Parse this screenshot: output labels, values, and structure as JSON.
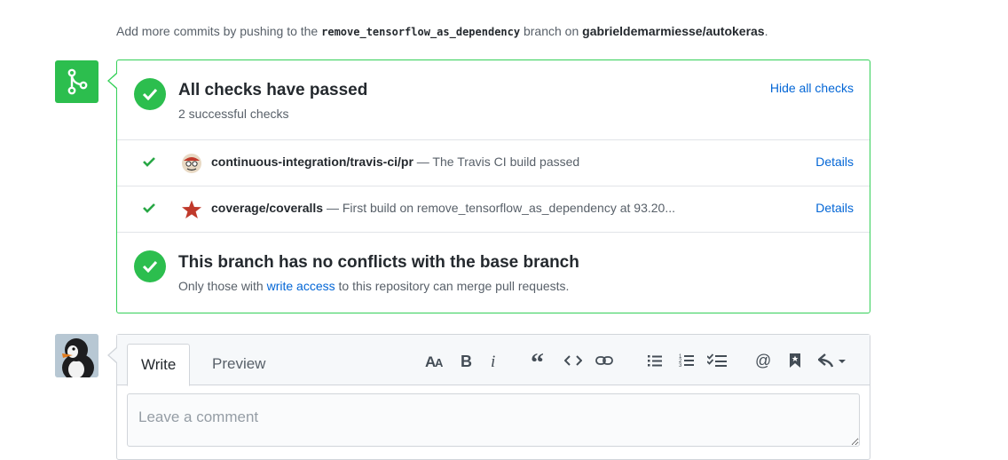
{
  "hint": {
    "prefix": "Add more commits by pushing to the",
    "branch": "remove_tensorflow_as_dependency",
    "middle": "branch on",
    "repo": "gabrieldemarmiesse/autokeras",
    "suffix": "."
  },
  "checks": {
    "title": "All checks have passed",
    "subtitle": "2 successful checks",
    "hide_label": "Hide all checks",
    "items": [
      {
        "name": "continuous-integration/travis-ci/pr",
        "description": "— The Travis CI build passed",
        "details_label": "Details",
        "icon": "travis-avatar-icon"
      },
      {
        "name": "coverage/coveralls",
        "description": "— First build on remove_tensorflow_as_dependency at 93.20...",
        "details_label": "Details",
        "icon": "coveralls-star-icon"
      }
    ]
  },
  "conflicts": {
    "title": "This branch has no conflicts with the base branch",
    "sub_prefix": "Only those with",
    "sub_link": "write access",
    "sub_suffix": "to this repository can merge pull requests."
  },
  "comment": {
    "tabs": [
      "Write",
      "Preview"
    ],
    "placeholder": "Leave a comment",
    "toolbar": [
      "text-size-icon",
      "bold-icon",
      "italic-icon",
      "quote-icon",
      "code-icon",
      "link-icon",
      "bulleted-list-icon",
      "numbered-list-icon",
      "task-list-icon",
      "mention-icon",
      "bookmark-icon",
      "reply-icon"
    ]
  },
  "colors": {
    "success": "#2cbe4e",
    "link": "#0366d6",
    "border_success": "#34d058"
  }
}
